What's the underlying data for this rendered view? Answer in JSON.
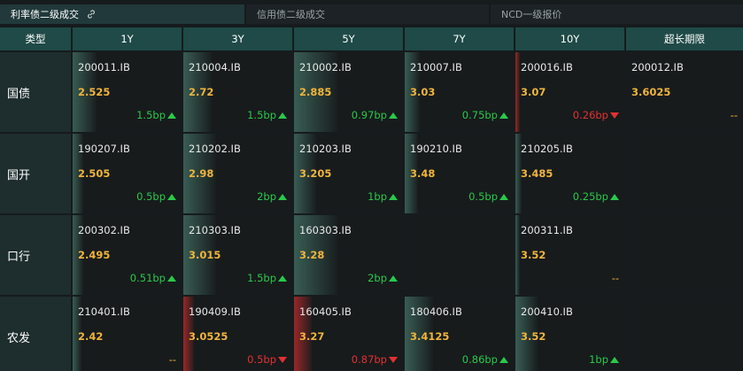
{
  "tabs": [
    {
      "label": "利率债二级成交",
      "active": true
    },
    {
      "label": "信用债二级成交",
      "active": false
    },
    {
      "label": "NCD一级报价",
      "active": false
    }
  ],
  "headers": [
    "类型",
    "1Y",
    "3Y",
    "5Y",
    "7Y",
    "10Y",
    "超长期限"
  ],
  "rows": [
    {
      "type": "国债",
      "cells": [
        {
          "code": "200011.IB",
          "yield": "2.525",
          "change": "1.5bp",
          "dir": "up",
          "bar": 0.22
        },
        {
          "code": "210004.IB",
          "yield": "2.72",
          "change": "1.5bp",
          "dir": "up",
          "bar": 0.26
        },
        {
          "code": "210002.IB",
          "yield": "2.885",
          "change": "0.97bp",
          "dir": "up",
          "bar": 0.4
        },
        {
          "code": "210007.IB",
          "yield": "3.03",
          "change": "0.75bp",
          "dir": "up",
          "bar": 0.14
        },
        {
          "code": "200016.IB",
          "yield": "3.07",
          "change": "0.26bp",
          "dir": "down",
          "bar": 0.04
        },
        {
          "code": "200012.IB",
          "yield": "3.6025",
          "change": "--",
          "dir": "flat",
          "bar": 0
        }
      ]
    },
    {
      "type": "国开",
      "cells": [
        {
          "code": "190207.IB",
          "yield": "2.505",
          "change": "0.5bp",
          "dir": "up",
          "bar": 0.1
        },
        {
          "code": "210202.IB",
          "yield": "2.98",
          "change": "2bp",
          "dir": "up",
          "bar": 0.3
        },
        {
          "code": "210203.IB",
          "yield": "3.205",
          "change": "1bp",
          "dir": "up",
          "bar": 0.2
        },
        {
          "code": "190210.IB",
          "yield": "3.48",
          "change": "0.5bp",
          "dir": "up",
          "bar": 0.12
        },
        {
          "code": "210205.IB",
          "yield": "3.485",
          "change": "0.25bp",
          "dir": "up",
          "bar": 0.06
        },
        {
          "code": "",
          "yield": "",
          "change": "",
          "dir": "none",
          "bar": 0
        }
      ]
    },
    {
      "type": "口行",
      "cells": [
        {
          "code": "200302.IB",
          "yield": "2.495",
          "change": "0.51bp",
          "dir": "up",
          "bar": 0.1
        },
        {
          "code": "210303.IB",
          "yield": "3.015",
          "change": "1.5bp",
          "dir": "up",
          "bar": 0.3
        },
        {
          "code": "160303.IB",
          "yield": "3.28",
          "change": "2bp",
          "dir": "up",
          "bar": 0.4
        },
        {
          "code": "",
          "yield": "",
          "change": "",
          "dir": "none",
          "bar": 0
        },
        {
          "code": "200311.IB",
          "yield": "3.52",
          "change": "--",
          "dir": "flat",
          "bar": 0.04
        },
        {
          "code": "",
          "yield": "",
          "change": "",
          "dir": "none",
          "bar": 0
        }
      ]
    },
    {
      "type": "农发",
      "cells": [
        {
          "code": "210401.IB",
          "yield": "2.42",
          "change": "--",
          "dir": "flat",
          "bar": 0.08
        },
        {
          "code": "190409.IB",
          "yield": "3.0525",
          "change": "0.5bp",
          "dir": "down",
          "bar": 0.1
        },
        {
          "code": "160405.IB",
          "yield": "3.27",
          "change": "0.87bp",
          "dir": "down",
          "bar": 0.16
        },
        {
          "code": "180406.IB",
          "yield": "3.4125",
          "change": "0.86bp",
          "dir": "up",
          "bar": 0.26
        },
        {
          "code": "200410.IB",
          "yield": "3.52",
          "change": "1bp",
          "dir": "up",
          "bar": 0.2
        },
        {
          "code": "",
          "yield": "",
          "change": "",
          "dir": "none",
          "bar": 0
        }
      ]
    }
  ]
}
